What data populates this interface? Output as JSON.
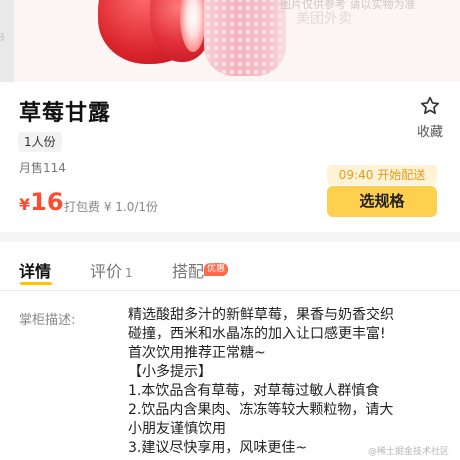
{
  "hero": {
    "watermark_line1": "图片仅供参考 请以实物为准",
    "watermark_line2": "美团外卖",
    "side_icon": "wifi-icon"
  },
  "product": {
    "title": "草莓甘露",
    "spec_tag": "1人份",
    "monthly_sales": "月售114",
    "price_currency": "¥",
    "price_value": "16",
    "packaging_fee": "打包费 ¥ 1.0/1份",
    "delivery_note": "09:40 开始配送",
    "choose_spec_label": "选规格"
  },
  "favorite": {
    "label": "收藏",
    "icon": "star-outline-icon"
  },
  "tabs": [
    {
      "label": "详情",
      "active": true
    },
    {
      "label": "评价",
      "count": "1",
      "active": false
    },
    {
      "label": "搭配",
      "badge": "优惠",
      "active": false
    }
  ],
  "description": {
    "label": "掌柜描述:",
    "lines": [
      "精选酸甜多汁的新鲜草莓，果香与奶香交织",
      "碰撞，西米和水晶冻的加入让口感更丰富!",
      "首次饮用推荐正常糖~",
      "【小多提示】",
      "1.本饮品含有草莓，对草莓过敏人群慎食",
      "2.饮品内含果肉、冻冻等较大颗粒物，请大",
      "小朋友谨慎饮用",
      "3.建议尽快享用，风味更佳~"
    ]
  },
  "footer_mark": "@稀土掘金技术社区",
  "colors": {
    "price": "#ff4c2e",
    "button": "#ffd04d",
    "delivery_bg": "#fff3d6",
    "delivery_text": "#e79b17",
    "tab_underline": "#ffc300",
    "badge": "#ff6a4d"
  }
}
